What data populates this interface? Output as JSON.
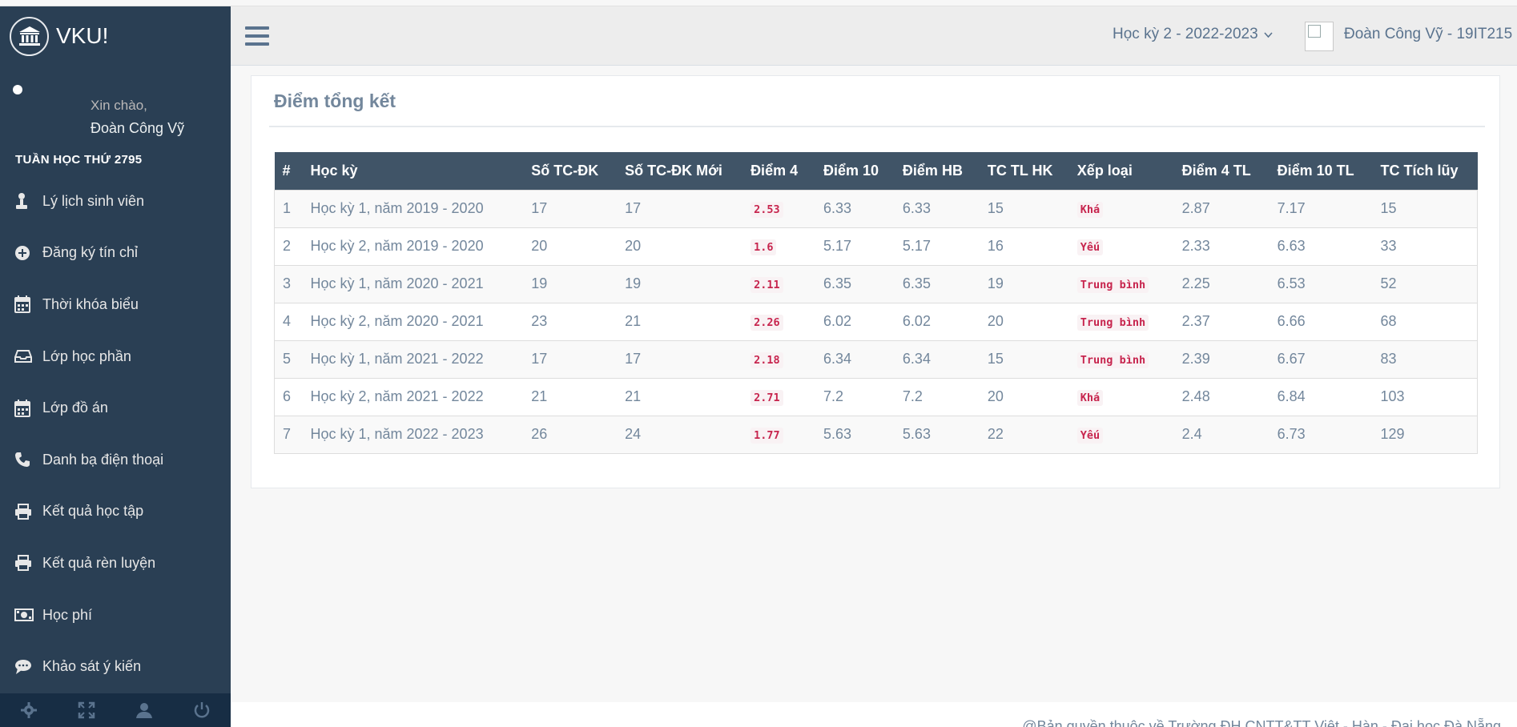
{
  "brand": {
    "name": "VKU!"
  },
  "profile": {
    "greeting": "Xin chào,",
    "name": "Đoàn Công Vỹ"
  },
  "sidebar": {
    "section_title": "TUẦN HỌC THỨ 2795",
    "items": [
      {
        "label": "Lý lịch sinh viên",
        "icon": "student-icon"
      },
      {
        "label": "Đăng ký tín chỉ",
        "icon": "plus-circle-icon"
      },
      {
        "label": "Thời khóa biểu",
        "icon": "calendar-icon"
      },
      {
        "label": "Lớp học phần",
        "icon": "inbox-icon"
      },
      {
        "label": "Lớp đồ án",
        "icon": "calendar-icon"
      },
      {
        "label": "Danh bạ điện thoại",
        "icon": "phone-icon"
      },
      {
        "label": "Kết quả học tập",
        "icon": "print-icon"
      },
      {
        "label": "Kết quả rèn luyện",
        "icon": "print-icon"
      },
      {
        "label": "Học phí",
        "icon": "money-icon"
      },
      {
        "label": "Khảo sát ý kiến",
        "icon": "comment-icon"
      }
    ],
    "footer_icons": [
      "gear-icon",
      "fullscreen-icon",
      "user-icon",
      "power-icon"
    ]
  },
  "topnav": {
    "semester": "Học kỳ 2 - 2022-2023",
    "user": "Đoàn Công Vỹ - 19IT215"
  },
  "panel": {
    "title": "Điểm tổng kết",
    "headers": [
      "#",
      "Học kỳ",
      "Số TC-ĐK",
      "Số TC-ĐK Mới",
      "Điểm 4",
      "Điểm 10",
      "Điểm HB",
      "TC TL HK",
      "Xếp loại",
      "Điểm 4 TL",
      "Điểm 10 TL",
      "TC Tích lũy"
    ],
    "rows": [
      [
        "1",
        "Học kỳ 1, năm 2019 - 2020",
        "17",
        "17",
        "2.53",
        "6.33",
        "6.33",
        "15",
        "Khá",
        "2.87",
        "7.17",
        "15"
      ],
      [
        "2",
        "Học kỳ 2, năm 2019 - 2020",
        "20",
        "20",
        "1.6",
        "5.17",
        "5.17",
        "16",
        "Yếu",
        "2.33",
        "6.63",
        "33"
      ],
      [
        "3",
        "Học kỳ 1, năm 2020 - 2021",
        "19",
        "19",
        "2.11",
        "6.35",
        "6.35",
        "19",
        "Trung bình",
        "2.25",
        "6.53",
        "52"
      ],
      [
        "4",
        "Học kỳ 2, năm 2020 - 2021",
        "23",
        "21",
        "2.26",
        "6.02",
        "6.02",
        "20",
        "Trung bình",
        "2.37",
        "6.66",
        "68"
      ],
      [
        "5",
        "Học kỳ 1, năm 2021 - 2022",
        "17",
        "17",
        "2.18",
        "6.34",
        "6.34",
        "15",
        "Trung bình",
        "2.39",
        "6.67",
        "83"
      ],
      [
        "6",
        "Học kỳ 2, năm 2021 - 2022",
        "21",
        "21",
        "2.71",
        "7.2",
        "7.2",
        "20",
        "Khá",
        "2.48",
        "6.84",
        "103"
      ],
      [
        "7",
        "Học kỳ 1, năm 2022 - 2023",
        "26",
        "24",
        "1.77",
        "5.63",
        "5.63",
        "22",
        "Yếu",
        "2.4",
        "6.73",
        "129"
      ]
    ]
  },
  "footer": {
    "text": "@Bản quyền thuộc về Trường ĐH CNTT&TT Việt - Hàn - Đại học Đà Nẵng"
  },
  "colors": {
    "sidebar": "#2a3f54",
    "table_header": "#405467",
    "code_text": "#c7254e",
    "code_bg": "#f9f2f4"
  }
}
